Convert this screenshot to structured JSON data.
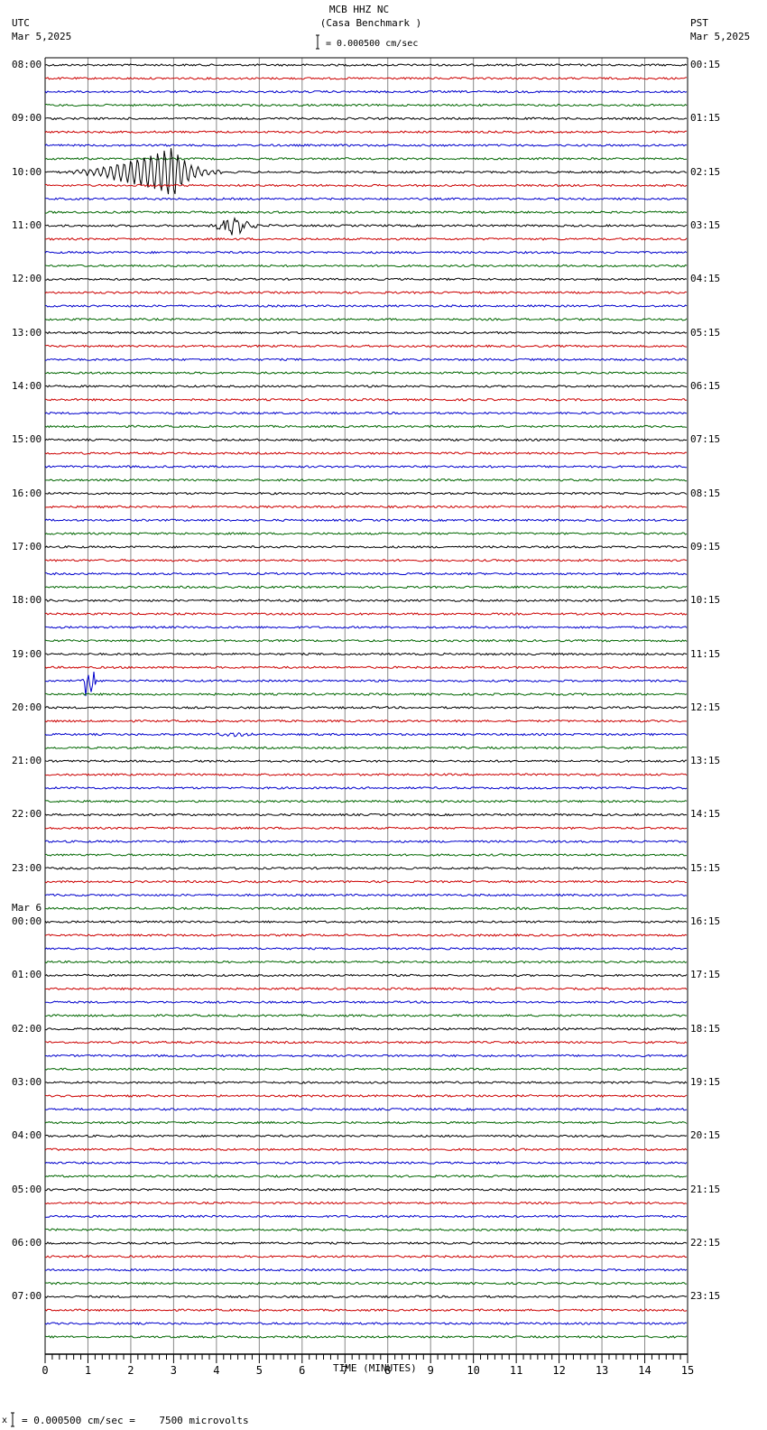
{
  "header": {
    "title": "MCB HHZ NC",
    "subtitle": "(Casa Benchmark )",
    "left_tz": "UTC",
    "left_date": "Mar 5,2025",
    "right_tz": "PST",
    "right_date": "Mar 5,2025",
    "scale_text": "= 0.000500 cm/sec"
  },
  "footer": {
    "scale_text": "= 0.000500 cm/sec =    7500 microvolts",
    "marker": "x"
  },
  "chart_data": {
    "type": "line",
    "title": "MCB HHZ NC (Casa Benchmark )",
    "xlabel": "TIME (MINUTES)",
    "xlim": [
      0,
      15
    ],
    "xticks": [
      "0",
      "1",
      "2",
      "3",
      "4",
      "5",
      "6",
      "7",
      "8",
      "9",
      "10",
      "11",
      "12",
      "13",
      "14",
      "15"
    ],
    "traces_per_hour": 4,
    "trace_count": 96,
    "trace_colors": [
      "#000000",
      "#cc0000",
      "#0000cc",
      "#006600"
    ],
    "left_labels": [
      "08:00",
      "09:00",
      "10:00",
      "11:00",
      "12:00",
      "13:00",
      "14:00",
      "15:00",
      "16:00",
      "17:00",
      "18:00",
      "19:00",
      "20:00",
      "21:00",
      "22:00",
      "23:00",
      "00:00",
      "01:00",
      "02:00",
      "03:00",
      "04:00",
      "05:00",
      "06:00",
      "07:00"
    ],
    "date_change_label": "Mar 6",
    "right_labels": [
      "00:15",
      "01:15",
      "02:15",
      "03:15",
      "04:15",
      "05:15",
      "06:15",
      "07:15",
      "08:15",
      "09:15",
      "10:15",
      "11:15",
      "12:15",
      "13:15",
      "14:15",
      "15:15",
      "16:15",
      "17:15",
      "18:15",
      "19:15",
      "20:15",
      "21:15",
      "22:15",
      "23:15"
    ],
    "events": [
      {
        "trace": 8,
        "start_min": 0.0,
        "peak_min": 3.0,
        "end_min": 6.0,
        "amplitude": 28,
        "kind": "surface"
      },
      {
        "trace": 12,
        "start_min": 3.7,
        "peak_min": 4.4,
        "end_min": 5.3,
        "amplitude": 14,
        "kind": "local"
      },
      {
        "trace": 46,
        "start_min": 0.85,
        "peak_min": 0.95,
        "end_min": 1.2,
        "amplitude": 18,
        "kind": "local"
      },
      {
        "trace": 50,
        "start_min": 3.2,
        "peak_min": 4.5,
        "end_min": 6.2,
        "amplitude": 2,
        "kind": "surface"
      }
    ]
  }
}
